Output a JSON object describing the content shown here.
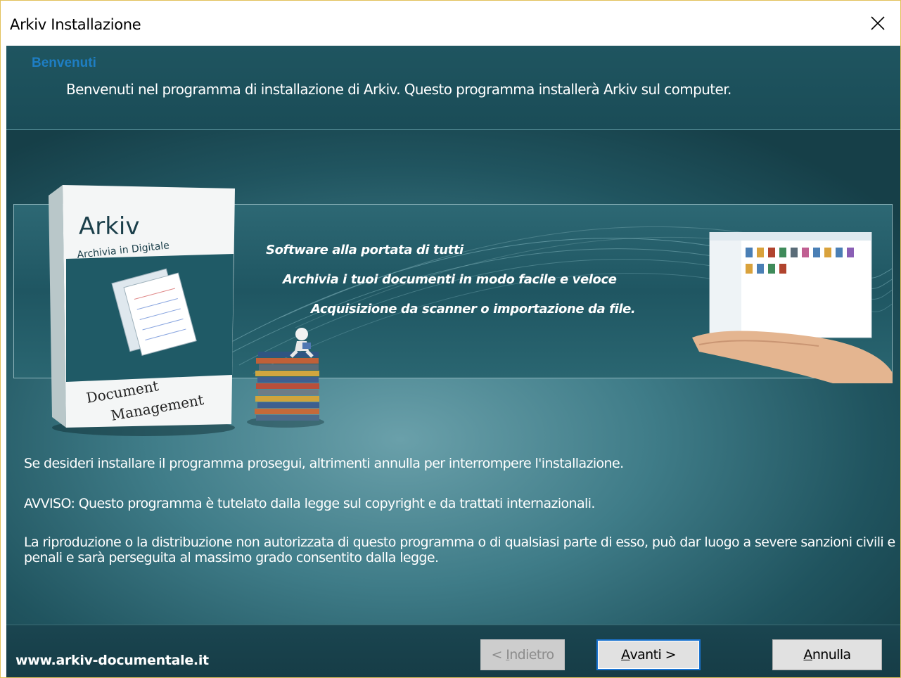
{
  "window": {
    "title": "Arkiv Installazione",
    "close_icon": "close-icon"
  },
  "header": {
    "title": "Benvenuti",
    "description": "Benvenuti nel programma di installazione di Arkiv. Questo programma installerà Arkiv sul computer."
  },
  "banner": {
    "product_box": {
      "name": "Arkiv",
      "subtitle": "Archivia in Digitale",
      "footer_line1": "Document",
      "footer_line2": "Management"
    },
    "taglines": [
      "Software alla portata di tutti",
      "Archivia i tuoi documenti in modo facile e veloce",
      "Acquisizione da scanner o importazione da file."
    ]
  },
  "body": {
    "message1": "Se desideri installare il programma prosegui, altrimenti annulla per interrompere l'installazione.",
    "message2": "AVVISO: Questo programma è tutelato dalla legge sul copyright e da trattati internazionali.",
    "message3": "La riproduzione o la distribuzione non autorizzata di questo programma o di qualsiasi parte di esso, può dar luogo a severe sanzioni civili e penali e sarà perseguita al massimo grado consentito dalla legge."
  },
  "footer": {
    "url": "www.arkiv-documentale.it",
    "back_label": "< Indietro",
    "back_access_key": "I",
    "back_pre": "< ",
    "back_rest": "ndietro",
    "next_access_key": "A",
    "next_rest": "vanti >",
    "cancel_access_key": "A",
    "cancel_rest": "nnulla",
    "back_enabled": false
  }
}
